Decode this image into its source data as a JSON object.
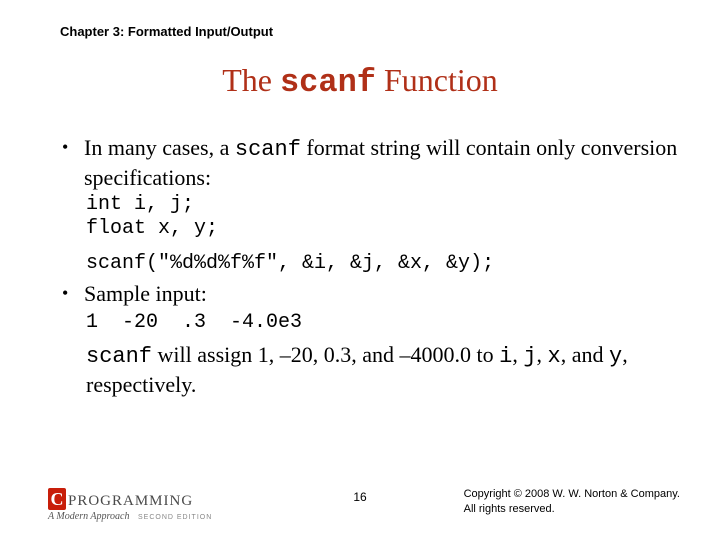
{
  "chapter": "Chapter 3: Formatted Input/Output",
  "title": {
    "pre": "The ",
    "code": "scanf",
    "post": " Function"
  },
  "bullet1": {
    "pre": "In many cases, a ",
    "code": "scanf",
    "post": " format string will contain only conversion specifications:"
  },
  "codeblock": "int i, j;\nfloat x, y;",
  "codeline": "scanf(\"%d%d%f%f\", &i, &j, &x, &y);",
  "bullet2": "Sample input:",
  "sampleinput": "1  -20  .3  -4.0e3",
  "explain": {
    "p1": "scanf",
    "p2": " will assign 1, –20, 0.3, and –4000.0 to ",
    "p3": "i",
    "p4": ", ",
    "p5": "j",
    "p6": ", ",
    "p7": "x",
    "p8": ", and ",
    "p9": "y",
    "p10": ", respectively."
  },
  "logo": {
    "c": "C",
    "text": "PROGRAMMING",
    "sub": "A Modern Approach",
    "edition": "SECOND EDITION"
  },
  "pagenum": "16",
  "copyright": {
    "l1": "Copyright © 2008 W. W. Norton & Company.",
    "l2": "All rights reserved."
  }
}
